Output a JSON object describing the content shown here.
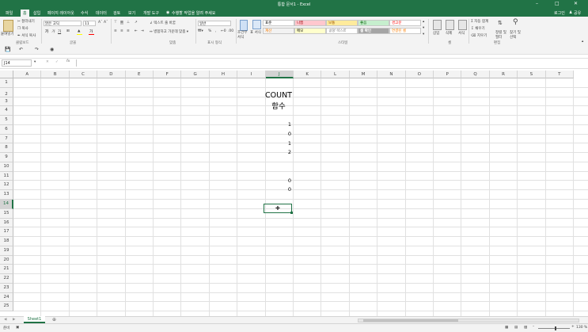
{
  "title_bar": {
    "title": "통합 문서1 - Excel",
    "user": "로그인",
    "share": "공유"
  },
  "tabs": [
    "파일",
    "홈",
    "삽입",
    "페이지 레이아웃",
    "수식",
    "데이터",
    "검토",
    "보기",
    "개발 도구"
  ],
  "active_tab": "홈",
  "tell_me": "수행할 작업을 알려 주세요",
  "ribbon": {
    "clipboard": {
      "paste": "붙여넣기",
      "cut": "잘라내기",
      "copy": "복사",
      "format_painter": "서식 복사",
      "group": "클립보드"
    },
    "font": {
      "name": "맑은 고딕",
      "size": "11",
      "group": "글꼴"
    },
    "alignment": {
      "wrap": "텍스트 줄 바꿈",
      "merge": "병합하고 가운데 맞춤",
      "group": "맞춤"
    },
    "number": {
      "format": "일반",
      "group": "표시 형식"
    },
    "conditional": {
      "label": "조건부 서식"
    },
    "table_format": {
      "label": "표 서식"
    },
    "styles": {
      "group": "스타일",
      "items": [
        {
          "label": "표준",
          "bg": "#ffffff",
          "fg": "#000000"
        },
        {
          "label": "나쁨",
          "bg": "#ffc7ce",
          "fg": "#9c0006"
        },
        {
          "label": "보통",
          "bg": "#ffeb9c",
          "fg": "#9c5700"
        },
        {
          "label": "좋음",
          "bg": "#c6efce",
          "fg": "#006100"
        },
        {
          "label": "경고문",
          "bg": "#ffffff",
          "fg": "#ff0000"
        },
        {
          "label": "계산",
          "bg": "#f2f2f2",
          "fg": "#fa7d00"
        },
        {
          "label": "메모",
          "bg": "#ffffcc",
          "fg": "#000000"
        },
        {
          "label": "설명 텍스트",
          "bg": "#ffffff",
          "fg": "#7f7f7f"
        },
        {
          "label": "셀 확인",
          "bg": "#a5a5a5",
          "fg": "#ffffff"
        },
        {
          "label": "연결된 셀",
          "bg": "#ffffff",
          "fg": "#fa7d00"
        }
      ]
    },
    "cells": {
      "insert": "삽입",
      "delete": "삭제",
      "format": "서식",
      "group": "셀"
    },
    "editing": {
      "autosum": "자동 합계",
      "fill": "채우기",
      "clear": "지우기",
      "sort": "정렬 및 필터",
      "find": "찾기 및 선택",
      "group": "편집"
    }
  },
  "name_box": "J14",
  "formula": "",
  "columns": [
    "A",
    "B",
    "C",
    "D",
    "E",
    "F",
    "G",
    "H",
    "I",
    "J",
    "K",
    "L",
    "M",
    "N",
    "O",
    "P",
    "Q",
    "R",
    "S",
    "T"
  ],
  "selected_column": "J",
  "rows": [
    "1",
    "2",
    "3",
    "4",
    "5",
    "6",
    "7",
    "8",
    "9",
    "10",
    "11",
    "12",
    "13",
    "14",
    "15",
    "16",
    "17",
    "18",
    "19",
    "20",
    "21",
    "22",
    "23",
    "24",
    "25"
  ],
  "selected_row": "14",
  "cells": {
    "j2": "COUNT 함수",
    "j5": "1",
    "j6": "0",
    "j7": "1",
    "j8": "2",
    "j11": "0",
    "j12": "0"
  },
  "sheet_tabs": [
    "Sheet1"
  ],
  "status": {
    "ready": "준비",
    "zoom": "130 %"
  }
}
